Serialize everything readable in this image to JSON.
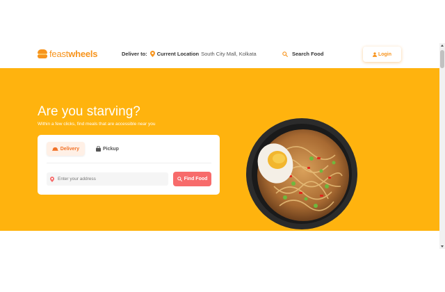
{
  "header": {
    "logo": {
      "word1": "feast",
      "word2": "wheels",
      "icon": "food-truck-icon"
    },
    "deliver_to_label": "Deliver to:",
    "current_location_label": "Current Location",
    "address": "South City Mall, Kolkata",
    "search_label": "Search Food",
    "login_label": "Login"
  },
  "hero": {
    "title": "Are you starving?",
    "subtitle": "Within a few clicks, find meals that are accessible near you",
    "tabs": [
      {
        "label": "Delivery",
        "icon": "delivery-icon",
        "active": true
      },
      {
        "label": "Pickup",
        "icon": "bag-icon",
        "active": false
      }
    ],
    "address_placeholder": "Enter your address",
    "find_button_label": "Find Food",
    "image": "noodle-bowl-with-egg"
  },
  "colors": {
    "brand": "#f7941d",
    "hero_bg": "#ffb30e",
    "find_button": "#f76b6b",
    "tab_active_text": "#f17228"
  }
}
